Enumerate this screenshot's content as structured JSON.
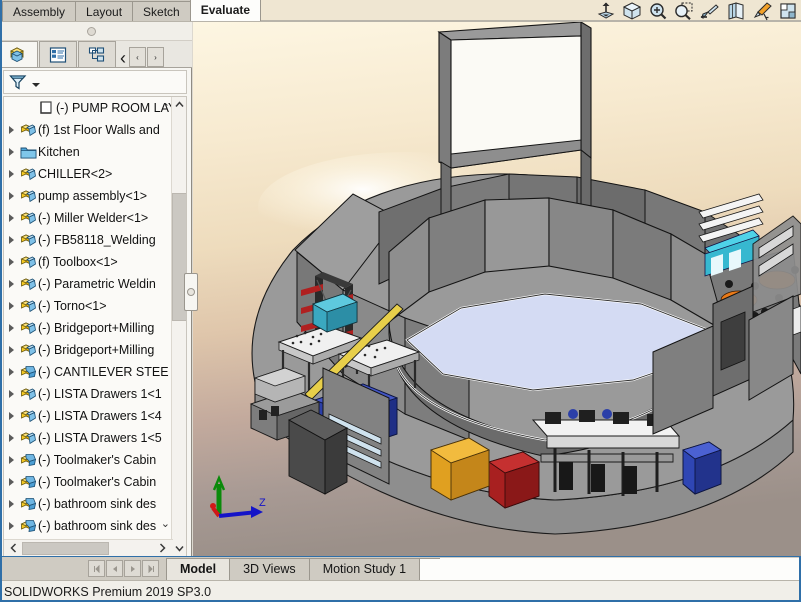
{
  "ribbon": {
    "tabs": [
      {
        "label": "Assembly",
        "active": false
      },
      {
        "label": "Layout",
        "active": false
      },
      {
        "label": "Sketch",
        "active": false
      },
      {
        "label": "Evaluate",
        "active": true
      }
    ],
    "toolbar_icons": [
      "section-view-icon",
      "view-orientation-icon",
      "zoom-to-area-icon",
      "zoom-to-fit-icon",
      "view-settings-icon",
      "display-style-icon",
      "appearances-icon",
      "scene-icon"
    ]
  },
  "left_panel": {
    "fm_tabs": [
      {
        "name": "feature-manager-tab",
        "icon": "solidworks-cube-icon",
        "active": true
      },
      {
        "name": "property-manager-tab",
        "icon": "property-list-icon",
        "active": false
      },
      {
        "name": "configuration-manager-tab",
        "icon": "configuration-icon",
        "active": false
      }
    ],
    "nav_back_label": "‹",
    "nav_forward_label": "›",
    "filter_placeholder": "",
    "filter_icon": "filter-funnel-icon",
    "tree": [
      {
        "label": "(-) PUMP ROOM LAY",
        "icon": "part-blank-icon",
        "expandable": false,
        "indent": 18
      },
      {
        "label": "(f) 1st Floor Walls and",
        "icon": "assembly-icon",
        "expandable": true,
        "indent": 0
      },
      {
        "label": "Kitchen",
        "icon": "folder-icon",
        "expandable": true,
        "indent": 0
      },
      {
        "label": "CHILLER<2>",
        "icon": "assembly-icon",
        "expandable": true,
        "indent": 0
      },
      {
        "label": "pump assembly<1>",
        "icon": "assembly-icon",
        "expandable": true,
        "indent": 0
      },
      {
        "label": "(-) Miller Welder<1>",
        "icon": "assembly-icon",
        "expandable": true,
        "indent": 0
      },
      {
        "label": "(-) FB58118_Welding",
        "icon": "assembly-icon",
        "expandable": true,
        "indent": 0
      },
      {
        "label": "(f) Toolbox<1>",
        "icon": "assembly-icon",
        "expandable": true,
        "indent": 0
      },
      {
        "label": "(-) Parametric Weldin",
        "icon": "assembly-icon",
        "expandable": true,
        "indent": 0
      },
      {
        "label": "(-) Torno<1>",
        "icon": "assembly-icon",
        "expandable": true,
        "indent": 0
      },
      {
        "label": "(-) Bridgeport+Milling",
        "icon": "assembly-icon",
        "expandable": true,
        "indent": 0
      },
      {
        "label": "(-) Bridgeport+Milling",
        "icon": "assembly-icon",
        "expandable": true,
        "indent": 0
      },
      {
        "label": "(-) CANTILEVER STEE",
        "icon": "assembly-blue-icon",
        "expandable": true,
        "indent": 0
      },
      {
        "label": "(-) LISTA Drawers 1<1",
        "icon": "assembly-icon",
        "expandable": true,
        "indent": 0
      },
      {
        "label": "(-) LISTA Drawers 1<4",
        "icon": "assembly-icon",
        "expandable": true,
        "indent": 0
      },
      {
        "label": "(-) LISTA Drawers 1<5",
        "icon": "assembly-icon",
        "expandable": true,
        "indent": 0
      },
      {
        "label": "(-) Toolmaker's Cabin",
        "icon": "assembly-blue-icon",
        "expandable": true,
        "indent": 0
      },
      {
        "label": "(-) Toolmaker's Cabin",
        "icon": "assembly-blue-icon",
        "expandable": true,
        "indent": 0
      },
      {
        "label": "(-) bathroom sink des",
        "icon": "assembly-blue-icon",
        "expandable": true,
        "indent": 0
      },
      {
        "label": "(-) bathroom sink des",
        "icon": "assembly-blue-icon",
        "expandable": true,
        "indent": 0
      }
    ],
    "scroll_up_label": "▲",
    "scroll_down_label": "▼",
    "hscroll_left_label": "‹",
    "hscroll_right_label": "›"
  },
  "graphics": {
    "model_name": "pump-room-layout-assembly",
    "background_top_color": "#faf0d8",
    "background_bottom_color": "#9e9289",
    "floor_color": "#d6ddf4",
    "wall_light": "#a0a0a0",
    "wall_mid": "#8a8a8a",
    "wall_dark": "#6e6e6e",
    "triad": {
      "x_label": "",
      "y_label": "",
      "z_label": "Z",
      "x_color": "#d01818",
      "y_color": "#0a8a0a",
      "z_color": "#1414c8"
    }
  },
  "bottom": {
    "nav_first": "⏮",
    "nav_prev": "◀",
    "nav_next": "▶",
    "nav_last": "⏭",
    "tabs": [
      {
        "label": "Model",
        "active": true
      },
      {
        "label": "3D Views",
        "active": false
      },
      {
        "label": "Motion Study 1",
        "active": false
      }
    ]
  },
  "status": {
    "text": "SOLIDWORKS Premium 2019 SP3.0"
  }
}
